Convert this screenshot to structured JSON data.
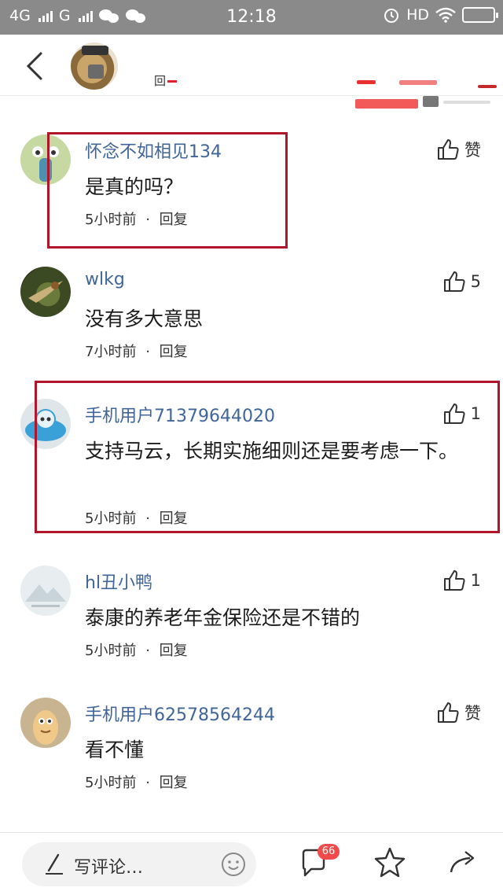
{
  "status_bar": {
    "network_1": "4G",
    "network_2": "G",
    "time": "12:18",
    "hd": "HD",
    "icons": [
      "signal-icon",
      "wechat-icon",
      "alarm-icon",
      "wifi-icon",
      "battery-icon"
    ]
  },
  "header": {
    "title_fragment": "回"
  },
  "comments": [
    {
      "name": "怀念不如相见134",
      "text": "是真的吗？",
      "time": "5小时前",
      "reply": "回复",
      "like": "赞"
    },
    {
      "name": "wlkg",
      "text": "没有多大意思",
      "time": "7小时前",
      "reply": "回复",
      "like": "5"
    },
    {
      "name": "手机用户71379644020",
      "text": "支持马云，长期实施细则还是要考虑一下。",
      "time": "5小时前",
      "reply": "回复",
      "like": "1"
    },
    {
      "name": "hl丑小鸭",
      "text": "泰康的养老年金保险还是不错的",
      "time": "5小时前",
      "reply": "回复",
      "like": "1"
    },
    {
      "name": "手机用户62578564244",
      "text": "看不懂",
      "time": "5小时前",
      "reply": "回复",
      "like": "赞"
    }
  ],
  "meta_separator": "·",
  "bottom_bar": {
    "composer_placeholder": "写评论…",
    "comment_count": "66"
  },
  "colors": {
    "name": "#406599",
    "highlight_box": "#b0152a",
    "badge": "#f04a4a",
    "status_bar": "#8a8a8a"
  }
}
